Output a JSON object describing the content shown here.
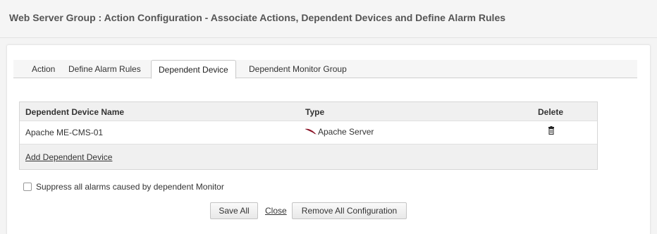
{
  "header": {
    "title": "Web Server Group : Action Configuration - Associate Actions, Dependent Devices and Define Alarm Rules"
  },
  "tabs": [
    {
      "label": "Action"
    },
    {
      "label": "Define Alarm Rules"
    },
    {
      "label": "Dependent Device",
      "active": true
    },
    {
      "label": "Dependent Monitor Group"
    }
  ],
  "table": {
    "columns": [
      "Dependent Device Name",
      "Type",
      "Delete"
    ],
    "rows": [
      {
        "name": "Apache ME-CMS-01",
        "type": "Apache Server",
        "type_icon": "apache-feather-icon",
        "delete_icon": "trash-icon"
      }
    ],
    "add_link": "Add Dependent Device"
  },
  "suppress": {
    "label": "Suppress all alarms caused by dependent Monitor",
    "checked": false
  },
  "actions": {
    "save": "Save All",
    "close": "Close",
    "remove": "Remove All Configuration"
  },
  "colors": {
    "apache_icon": "#a0182e"
  }
}
